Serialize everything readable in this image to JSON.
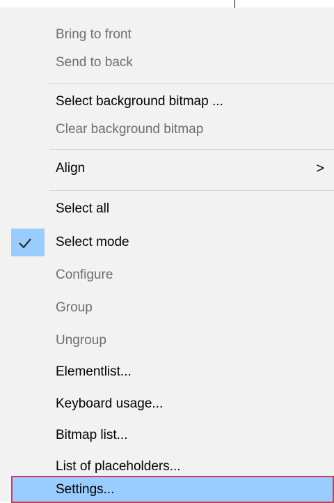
{
  "menu": {
    "items": [
      {
        "label": "Bring to front",
        "enabled": false
      },
      {
        "label": "Send to back",
        "enabled": false
      },
      {
        "label": "Select background bitmap ...",
        "enabled": true
      },
      {
        "label": "Clear background bitmap",
        "enabled": false
      },
      {
        "label": "Align",
        "enabled": true,
        "submenu_arrow": ">"
      },
      {
        "label": "Select all",
        "enabled": true
      },
      {
        "label": "Select mode",
        "enabled": true,
        "checked": true
      },
      {
        "label": "Configure",
        "enabled": false
      },
      {
        "label": "Group",
        "enabled": false
      },
      {
        "label": "Ungroup",
        "enabled": false
      },
      {
        "label": "Elementlist...",
        "enabled": true
      },
      {
        "label": "Keyboard usage...",
        "enabled": true
      },
      {
        "label": "Bitmap list...",
        "enabled": true
      },
      {
        "label": "List of placeholders...",
        "enabled": true
      },
      {
        "label": "Settings...",
        "enabled": true,
        "highlighted": true
      }
    ]
  },
  "colors": {
    "menu_background": "#f2f2f2",
    "highlight_fill": "#99ccff",
    "highlight_border": "#d3375a",
    "disabled_text": "#6d6d6d",
    "enabled_text": "#000000",
    "separator": "#d7d7d7"
  },
  "icons": {
    "check": "checkmark-icon",
    "submenu": "chevron-right-icon"
  }
}
